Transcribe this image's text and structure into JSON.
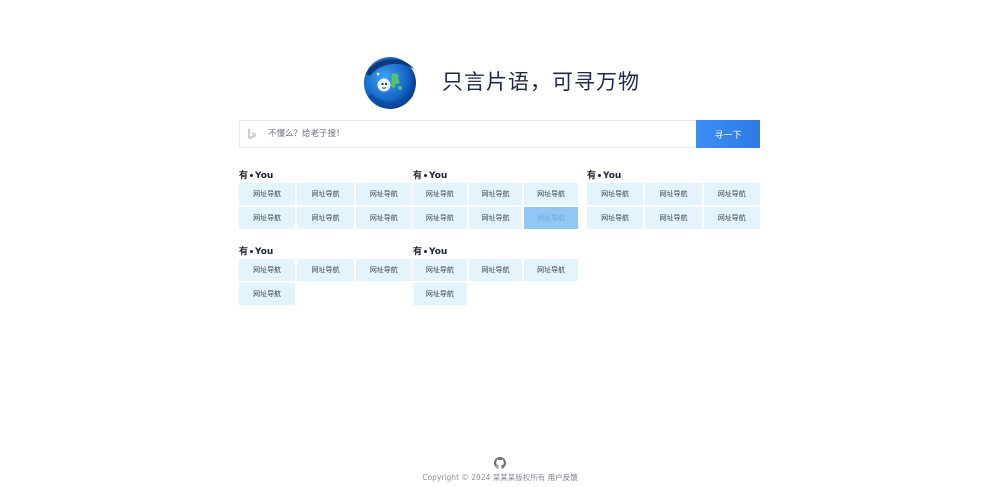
{
  "hero": {
    "slogan": "只言片语，可寻万物"
  },
  "search": {
    "engine_icon": "bing-icon",
    "placeholder": "不懂么？给老子搜！",
    "value": "",
    "button_label": "寻一下"
  },
  "groups": [
    {
      "title_prefix": "有",
      "title_suffix": "You",
      "links": [
        "网址导航",
        "网址导航",
        "网址导航",
        "网址导航",
        "网址导航",
        "网址导航"
      ]
    },
    {
      "title_prefix": "有",
      "title_suffix": "You",
      "links": [
        "网址导航",
        "网址导航",
        "网址导航",
        "网址导航",
        "网址导航",
        "网址导航"
      ]
    },
    {
      "title_prefix": "有",
      "title_suffix": "You",
      "links": [
        "网址导航",
        "网址导航",
        "网址导航",
        "网址导航",
        "网址导航",
        "网址导航"
      ]
    },
    {
      "title_prefix": "有",
      "title_suffix": "You",
      "links": [
        "网址导航",
        "网址导航",
        "网址导航",
        "网址导航"
      ]
    },
    {
      "title_prefix": "有",
      "title_suffix": "You",
      "links": [
        "网址导航",
        "网址导航",
        "网址导航",
        "网址导航"
      ]
    }
  ],
  "footer": {
    "icon": "github-icon",
    "copyright": "Copyright © 2024 某某某版权所有",
    "feedback_link": "用户反馈"
  },
  "colors": {
    "accent": "#3a8ef6",
    "link_bg": "#e3f4fd",
    "link_hover_bg": "#8fc8f4"
  }
}
